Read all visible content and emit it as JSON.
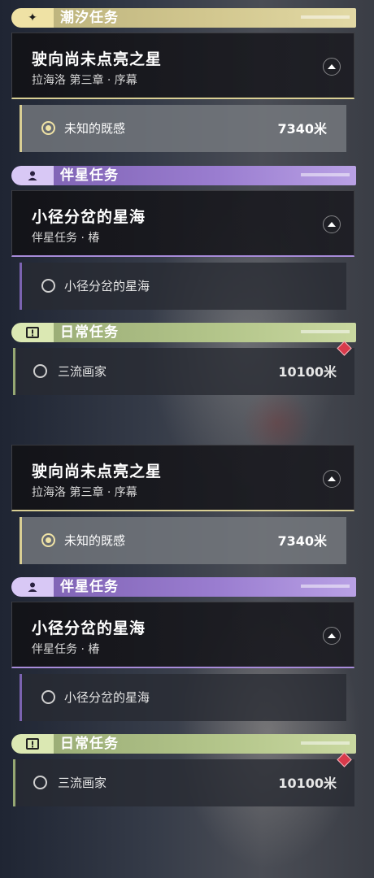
{
  "colors": {
    "trailblaze_accent": "#efe2a5",
    "companion_accent": "#a78bd9",
    "daily_accent": "#b3c58a",
    "active_objective_bg": "#7c7f85",
    "marker_red": "#d83a4b"
  },
  "panels": [
    {
      "trailblaze": {
        "header_label": "潮汐任务",
        "header_icon": "sparkle-star-icon",
        "quest_title": "驶向尚未点亮之星",
        "quest_subtitle": "拉海洛 第三章 · 序幕",
        "nav_icon": "navigate-arrow-icon",
        "objective_text": "未知的既感",
        "objective_distance": "7340米",
        "objective_selected": true
      },
      "companion": {
        "header_label": "伴星任务",
        "header_icon": "person-icon",
        "quest_title": "小径分岔的星海",
        "quest_subtitle": "伴星任务 · 椿",
        "nav_icon": "navigate-arrow-icon",
        "objective_text": "小径分岔的星海",
        "objective_selected": false
      },
      "daily": {
        "header_label": "日常任务",
        "header_icon": "exclamation-box-icon",
        "objective_text": "三流画家",
        "objective_distance": "10100米",
        "objective_selected": false,
        "marker_icon": "red-diamond-marker-icon"
      }
    },
    {
      "trailblaze": {
        "quest_title": "驶向尚未点亮之星",
        "quest_subtitle": "拉海洛 第三章 · 序幕",
        "nav_icon": "navigate-arrow-icon",
        "objective_text": "未知的既感",
        "objective_distance": "7340米",
        "objective_selected": true
      },
      "companion": {
        "header_label": "伴星任务",
        "header_icon": "person-icon",
        "quest_title": "小径分岔的星海",
        "quest_subtitle": "伴星任务 · 椿",
        "nav_icon": "navigate-arrow-icon",
        "objective_text": "小径分岔的星海",
        "objective_selected": false
      },
      "daily": {
        "header_label": "日常任务",
        "header_icon": "exclamation-box-icon",
        "objective_text": "三流画家",
        "objective_distance": "10100米",
        "objective_selected": false,
        "marker_icon": "red-diamond-marker-icon"
      }
    }
  ]
}
